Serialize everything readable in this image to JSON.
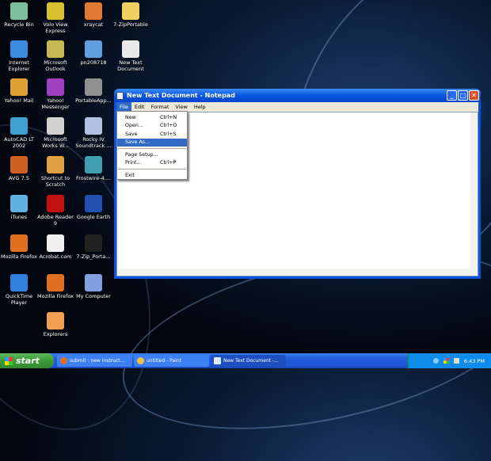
{
  "desktop": {
    "icons": [
      {
        "label": "Recycle Bin",
        "color": "#7cc0a0",
        "col": 0,
        "row": 0
      },
      {
        "label": "Volo View Express",
        "color": "#d8c030",
        "col": 1,
        "row": 0
      },
      {
        "label": "xraycat",
        "color": "#e07a30",
        "col": 2,
        "row": 0
      },
      {
        "label": "7-ZipPortable",
        "color": "#f0d060",
        "col": 3,
        "row": 0
      },
      {
        "label": "Internet Explorer",
        "color": "#3a8ae0",
        "col": 0,
        "row": 1
      },
      {
        "label": "Microsoft Outlook",
        "color": "#c8b850",
        "col": 1,
        "row": 1
      },
      {
        "label": "pn208718",
        "color": "#60a0e0",
        "col": 2,
        "row": 1
      },
      {
        "label": "New Text Document",
        "color": "#e8e8e8",
        "col": 3,
        "row": 1
      },
      {
        "label": "Yahoo! Mail",
        "color": "#e0a030",
        "col": 0,
        "row": 2
      },
      {
        "label": "Yahoo! Messenger",
        "color": "#a040c0",
        "col": 1,
        "row": 2
      },
      {
        "label": "PortableApp...",
        "color": "#909090",
        "col": 2,
        "row": 2
      },
      {
        "label": "AutoCAD LT 2002",
        "color": "#40a0d0",
        "col": 0,
        "row": 3
      },
      {
        "label": "Microsoft Works W...",
        "color": "#d0d0d0",
        "col": 1,
        "row": 3
      },
      {
        "label": "Rocky IV Soundtrack ...",
        "color": "#b0c0e0",
        "col": 2,
        "row": 3
      },
      {
        "label": "AVG 7.5",
        "color": "#d06020",
        "col": 0,
        "row": 4
      },
      {
        "label": "Shortcut to Scratch",
        "color": "#e0a040",
        "col": 1,
        "row": 4
      },
      {
        "label": "Frostwire-4....",
        "color": "#40a0b0",
        "col": 2,
        "row": 4
      },
      {
        "label": "iTunes",
        "color": "#60b0e0",
        "col": 0,
        "row": 5
      },
      {
        "label": "Adobe Reader 9",
        "color": "#c01010",
        "col": 1,
        "row": 5
      },
      {
        "label": "Google Earth",
        "color": "#2050b0",
        "col": 2,
        "row": 5
      },
      {
        "label": "Mozilla Firefox",
        "color": "#e07020",
        "col": 0,
        "row": 6
      },
      {
        "label": "Acrobat.com",
        "color": "#f0f0f0",
        "col": 1,
        "row": 6
      },
      {
        "label": "7-Zip_Porta...",
        "color": "#222222",
        "col": 2,
        "row": 6
      },
      {
        "label": "QuickTime Player",
        "color": "#3080e0",
        "col": 0,
        "row": 7
      },
      {
        "label": "Mozilla Firefox",
        "color": "#e07020",
        "col": 1,
        "row": 7
      },
      {
        "label": "My Computer",
        "color": "#80a0e0",
        "col": 2,
        "row": 7
      },
      {
        "label": "Explorers",
        "color": "#f0a050",
        "col": 1,
        "row": 8
      }
    ]
  },
  "notepad": {
    "title": "New Text Document - Notepad",
    "menu": [
      "File",
      "Edit",
      "Format",
      "View",
      "Help"
    ],
    "file_menu": [
      {
        "label": "New",
        "shortcut": "Ctrl+N"
      },
      {
        "label": "Open...",
        "shortcut": "Ctrl+O"
      },
      {
        "label": "Save",
        "shortcut": "Ctrl+S"
      },
      {
        "label": "Save As...",
        "shortcut": "",
        "highlighted": true
      },
      {
        "separator": true
      },
      {
        "label": "Page Setup...",
        "shortcut": ""
      },
      {
        "label": "Print...",
        "shortcut": "Ctrl+P"
      },
      {
        "separator": true
      },
      {
        "label": "Exit",
        "shortcut": ""
      }
    ],
    "buttons": {
      "minimize": "_",
      "maximize": "□",
      "close": "✕"
    }
  },
  "taskbar": {
    "start": "start",
    "tasks": [
      {
        "label": "submit : new instruct...",
        "icon": "firefox-icon",
        "color": "#e07020"
      },
      {
        "label": "untitled - Paint",
        "icon": "paint-icon",
        "color": "#f0c040"
      },
      {
        "label": "New Text Document -...",
        "icon": "notepad-icon",
        "color": "#e0e8ff",
        "active": true
      }
    ],
    "clock": "6:43 PM"
  }
}
